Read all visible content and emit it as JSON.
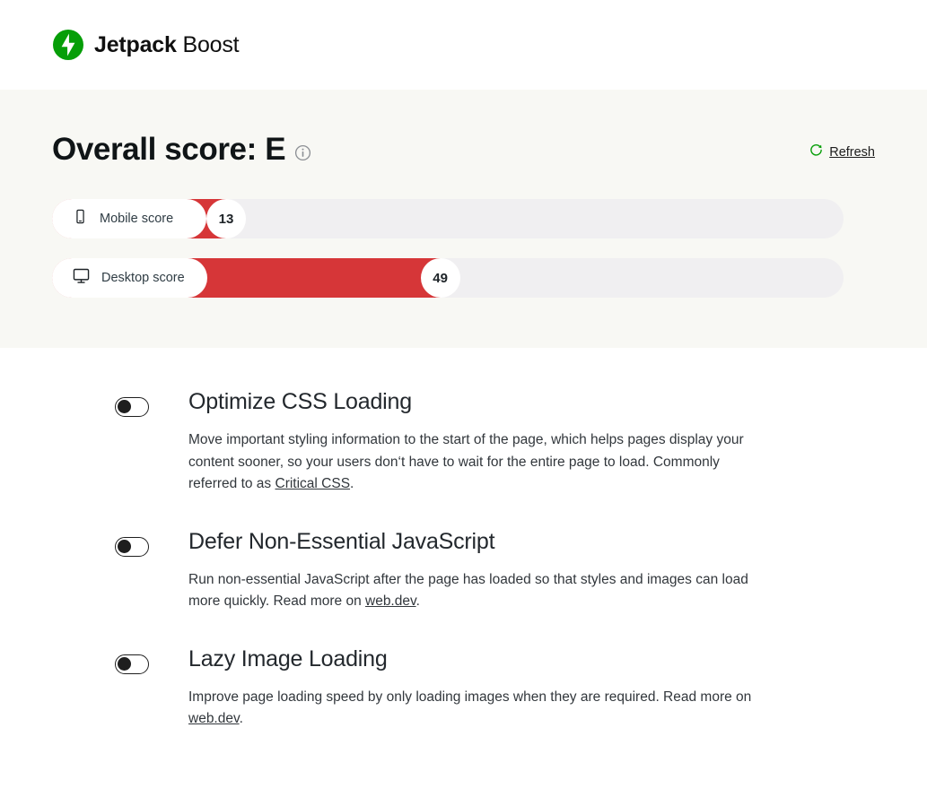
{
  "header": {
    "brand_bold": "Jetpack",
    "brand_light": " Boost",
    "logo_icon": "jetpack-logo-icon"
  },
  "score_panel": {
    "title": "Overall score: E",
    "info_icon": "info-icon",
    "refresh": {
      "label": "Refresh",
      "icon": "refresh-icon",
      "color": "#069e08"
    },
    "fill_color": "#d63638",
    "track_color": "#f0eff1",
    "bars": [
      {
        "label": "Mobile score",
        "icon": "mobile-phone-icon",
        "value": 13,
        "label_pill_width": 172
      },
      {
        "label": "Desktop score",
        "icon": "desktop-monitor-icon",
        "value": 49,
        "label_pill_width": 173
      }
    ]
  },
  "modules": [
    {
      "title": "Optimize CSS Loading",
      "toggle_state": "off",
      "desc_before": "Move important styling information to the start of the page, which helps pages display your content sooner, so your users don‘t have to wait for the entire page to load. Commonly referred to as ",
      "link_text": "Critical CSS",
      "desc_after": "."
    },
    {
      "title": "Defer Non-Essential JavaScript",
      "toggle_state": "off",
      "desc_before": "Run non-essential JavaScript after the page has loaded so that styles and images can load more quickly. Read more on ",
      "link_text": "web.dev",
      "desc_after": "."
    },
    {
      "title": "Lazy Image Loading",
      "toggle_state": "off",
      "desc_before": "Improve page loading speed by only loading images when they are required. Read more on ",
      "link_text": "web.dev",
      "desc_after": "."
    }
  ]
}
